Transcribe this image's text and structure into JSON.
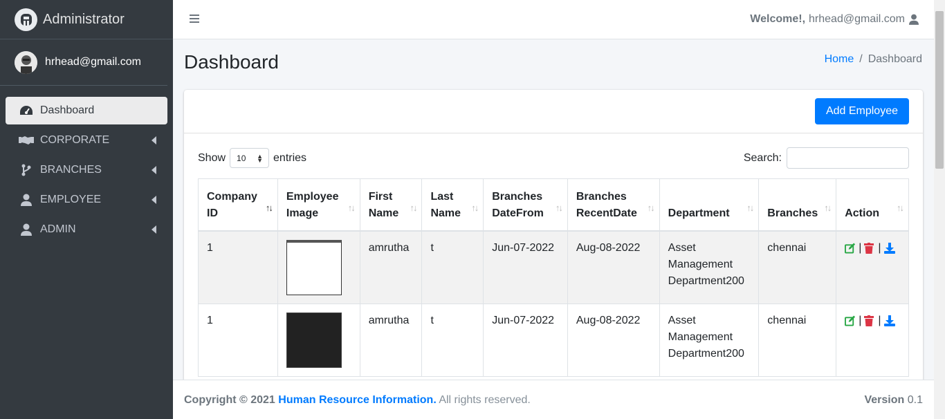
{
  "brand": {
    "title": "Administrator"
  },
  "user": {
    "email": "hrhead@gmail.com"
  },
  "sidebar": {
    "items": [
      {
        "label": "Dashboard",
        "icon": "tachometer-icon"
      },
      {
        "label": "CORPORATE",
        "icon": "handshake-icon"
      },
      {
        "label": "BRANCHES",
        "icon": "code-branch-icon"
      },
      {
        "label": "EMPLOYEE",
        "icon": "user-icon"
      },
      {
        "label": "ADMIN",
        "icon": "user-icon"
      }
    ]
  },
  "topbar": {
    "welcome_label": "Welcome!,",
    "welcome_user": "hrhead@gmail.com"
  },
  "page": {
    "title": "Dashboard"
  },
  "breadcrumb": {
    "home": "Home",
    "sep": "/",
    "current": "Dashboard"
  },
  "card": {
    "add_button": "Add Employee"
  },
  "datatable": {
    "show": "Show",
    "length": "10",
    "entries": "entries",
    "search_label": "Search:",
    "search_value": ""
  },
  "table": {
    "headers": [
      "Company ID",
      "Employee Image",
      "First Name",
      "Last Name",
      "Branches DateFrom",
      "Branches RecentDate",
      "Department",
      "Branches",
      "Action"
    ],
    "rows": [
      {
        "company_id": "1",
        "first_name": "amrutha",
        "last_name": "t",
        "date_from": "Jun-07-2022",
        "recent_date": "Aug-08-2022",
        "department": "Asset Management Department200",
        "branch": "chennai"
      },
      {
        "company_id": "1",
        "first_name": "amrutha",
        "last_name": "t",
        "date_from": "Jun-07-2022",
        "recent_date": "Aug-08-2022",
        "department": "Asset Management Department200",
        "branch": "chennai"
      }
    ],
    "action_sep": "|"
  },
  "footer": {
    "copyright": "Copyright © 2021",
    "org": "Human Resource Information.",
    "rights": "All rights reserved.",
    "version_label": "Version",
    "version": "0.1"
  },
  "colors": {
    "primary": "#007bff",
    "sidebar": "#343a40",
    "edit": "#28a745",
    "delete": "#dc3545",
    "download": "#007bff"
  }
}
